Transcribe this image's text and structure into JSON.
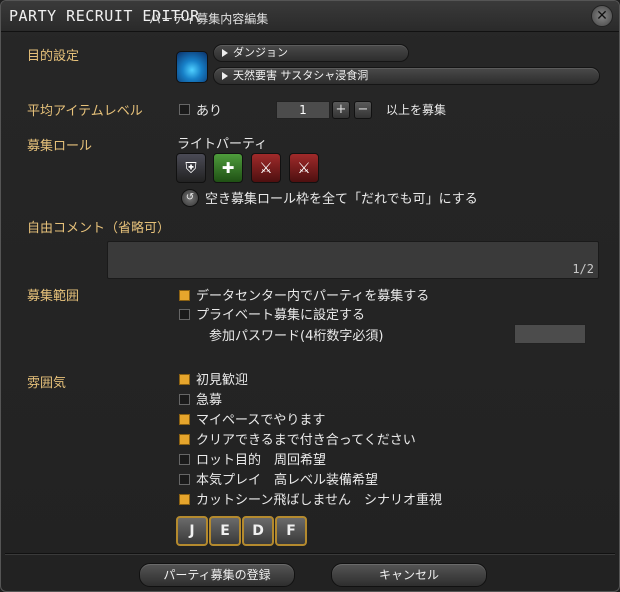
{
  "window": {
    "title_en": "PARTY RECRUIT EDITOR",
    "title_jp": "パーティ募集内容編集"
  },
  "objective": {
    "label": "目的設定",
    "category": "ダンジョン",
    "duty": "天然要害 サスタシャ浸食洞"
  },
  "item_level": {
    "label": "平均アイテムレベル",
    "checkbox_label": "あり",
    "checked": false,
    "value": "1",
    "plus": "+",
    "minus": "−",
    "suffix": "以上を募集"
  },
  "roles": {
    "label": "募集ロール",
    "party_type": "ライトパーティ",
    "slots": [
      {
        "role": "tank",
        "icon": "shield-icon",
        "glyph": "⛨"
      },
      {
        "role": "healer",
        "icon": "healer-cross-icon",
        "glyph": "✚"
      },
      {
        "role": "dps",
        "icon": "sword-icon",
        "glyph": "⚔"
      },
      {
        "role": "dps",
        "icon": "sword-icon",
        "glyph": "⚔"
      }
    ],
    "reset_glyph": "↺",
    "reset_text": "空き募集ロール枠を全て「だれでも可」にする"
  },
  "comment": {
    "label": "自由コメント（省略可）",
    "value": "",
    "counter": "1/2"
  },
  "scope": {
    "label": "募集範囲",
    "options": [
      {
        "text": "データセンター内でパーティを募集する",
        "checked": true
      },
      {
        "text": "プライベート募集に設定する",
        "checked": false
      }
    ],
    "password_label": "参加パスワード(4桁数字必須)",
    "password_value": ""
  },
  "atmosphere": {
    "label": "雰囲気",
    "options": [
      {
        "text": "初見歓迎",
        "checked": true
      },
      {
        "text": "急募",
        "checked": false
      },
      {
        "text": "マイペースでやります",
        "checked": true
      },
      {
        "text": "クリアできるまで付き合ってください",
        "checked": true
      },
      {
        "text": "ロット目的　周回希望",
        "checked": false
      },
      {
        "text": "本気プレイ　高レベル装備希望",
        "checked": false
      },
      {
        "text": "カットシーン飛ばしません　シナリオ重視",
        "checked": true
      }
    ]
  },
  "languages": [
    "J",
    "E",
    "D",
    "F"
  ],
  "footer": {
    "submit": "パーティ募集の登録",
    "cancel": "キャンセル"
  },
  "colors": {
    "accent_label": "#e6c17a",
    "checkbox_on": "#e6a52c",
    "language_border": "#b48a2e"
  }
}
